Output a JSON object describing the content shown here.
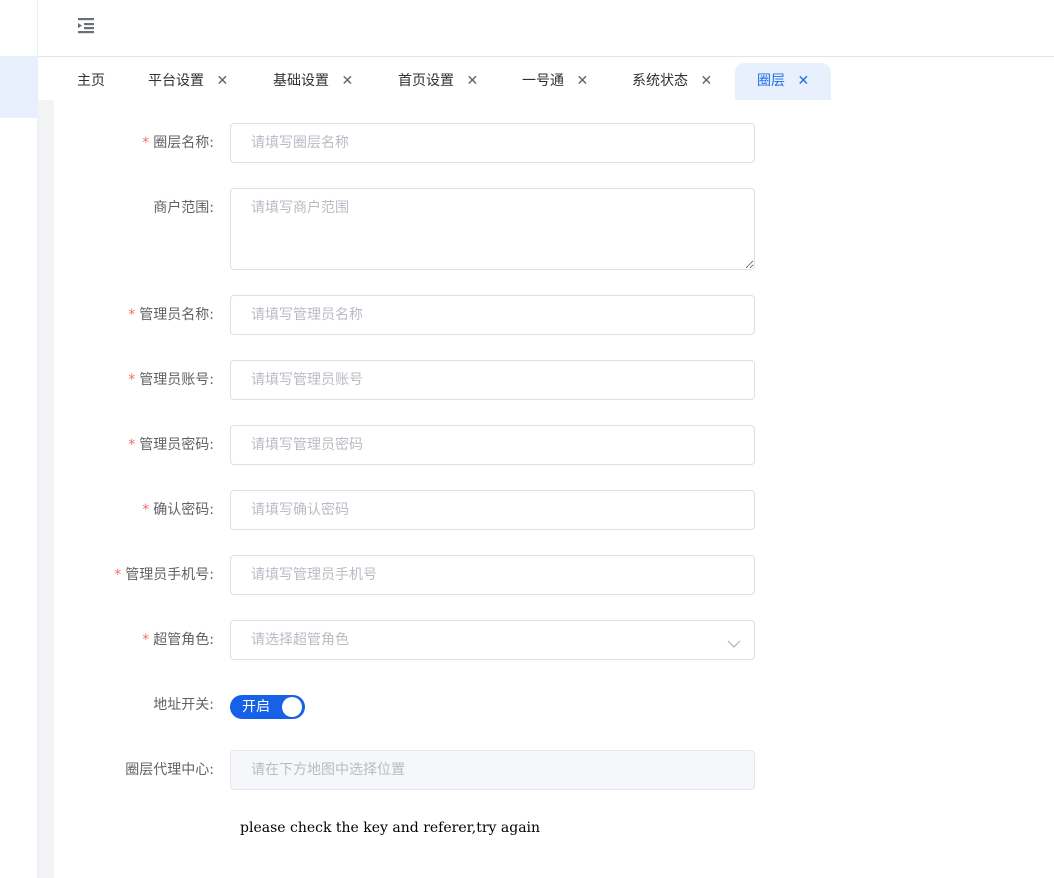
{
  "header": {
    "menu_toggle_icon": "menu-fold-icon"
  },
  "tabs": [
    {
      "label": "主页",
      "closable": false
    },
    {
      "label": "平台设置",
      "closable": true
    },
    {
      "label": "基础设置",
      "closable": true
    },
    {
      "label": "首页设置",
      "closable": true
    },
    {
      "label": "一号通",
      "closable": true
    },
    {
      "label": "系统状态",
      "closable": true
    },
    {
      "label": "圈层",
      "closable": true,
      "active": true
    }
  ],
  "close_glyph": "✕",
  "form": {
    "required_mark": "*",
    "circle_name": {
      "label": "圈层名称:",
      "placeholder": "请填写圈层名称"
    },
    "merchant_scope": {
      "label": "商户范围:",
      "placeholder": "请填写商户范围"
    },
    "admin_name": {
      "label": "管理员名称:",
      "placeholder": "请填写管理员名称"
    },
    "admin_account": {
      "label": "管理员账号:",
      "placeholder": "请填写管理员账号"
    },
    "admin_password": {
      "label": "管理员密码:",
      "placeholder": "请填写管理员密码"
    },
    "confirm_password": {
      "label": "确认密码:",
      "placeholder": "请填写确认密码"
    },
    "admin_phone": {
      "label": "管理员手机号:",
      "placeholder": "请填写管理员手机号"
    },
    "super_role": {
      "label": "超管角色:",
      "placeholder": "请选择超管角色"
    },
    "address_switch": {
      "label": "地址开关:",
      "on_text": "开启",
      "state": "on"
    },
    "agent_center": {
      "label": "圈层代理中心:",
      "placeholder": "请在下方地图中选择位置"
    }
  },
  "map_error": "please check the key and referer,try again",
  "colors": {
    "primary": "#1661e8",
    "active_tab_bg": "#e8f0fe",
    "required": "#f56c6c"
  }
}
